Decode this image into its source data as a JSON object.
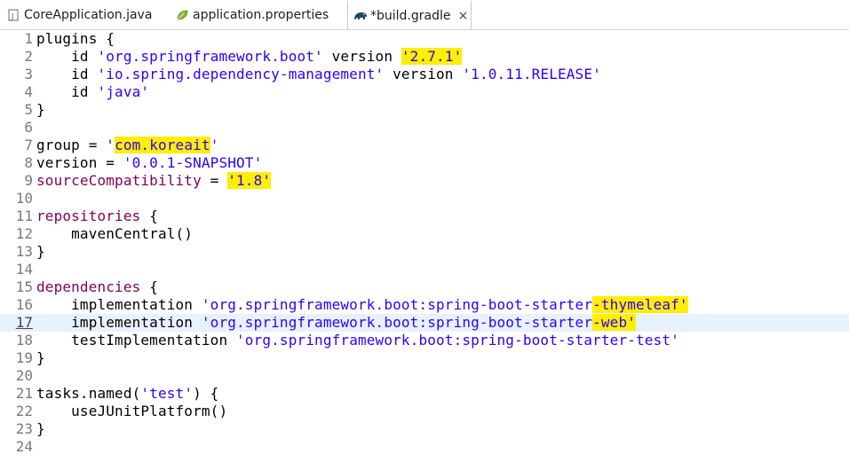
{
  "tabs": [
    {
      "label": "CoreApplication.java",
      "icon": "java-file-icon"
    },
    {
      "label": "application.properties",
      "icon": "properties-leaf-icon"
    },
    {
      "label": "*build.gradle",
      "icon": "gradle-elephant-icon",
      "close": "×"
    }
  ],
  "colors": {
    "string": "#2a00ff",
    "highlight": "#ffee00",
    "current_line": "#e8f2fe"
  },
  "lines": [
    {
      "n": "1",
      "parts": [
        [
          "plugins {",
          ""
        ]
      ]
    },
    {
      "n": "2",
      "parts": [
        [
          "    id ",
          ""
        ],
        [
          "'org.springframework.boot'",
          "s"
        ],
        [
          " version ",
          ""
        ],
        [
          "'2.7.1'",
          "s hl"
        ]
      ]
    },
    {
      "n": "3",
      "parts": [
        [
          "    id ",
          ""
        ],
        [
          "'io.spring.dependency-management'",
          "s"
        ],
        [
          " version ",
          ""
        ],
        [
          "'1.0.11.RELEASE'",
          "s"
        ]
      ]
    },
    {
      "n": "4",
      "parts": [
        [
          "    id ",
          ""
        ],
        [
          "'java'",
          "s"
        ]
      ]
    },
    {
      "n": "5",
      "parts": [
        [
          "}",
          ""
        ]
      ]
    },
    {
      "n": "6",
      "parts": []
    },
    {
      "n": "7",
      "parts": [
        [
          "group = ",
          ""
        ],
        [
          "'",
          "s"
        ],
        [
          "com.koreait",
          "s hl"
        ],
        [
          "'",
          "s"
        ]
      ]
    },
    {
      "n": "8",
      "parts": [
        [
          "version = ",
          ""
        ],
        [
          "'0.0.1-SNAPSHOT'",
          "s"
        ]
      ]
    },
    {
      "n": "9",
      "parts": [
        [
          "sourceCompatibility",
          "k"
        ],
        [
          " = ",
          ""
        ],
        [
          "'1.8'",
          "s hl"
        ]
      ]
    },
    {
      "n": "10",
      "parts": []
    },
    {
      "n": "11",
      "parts": [
        [
          "repositories",
          "k"
        ],
        [
          " {",
          ""
        ]
      ]
    },
    {
      "n": "12",
      "parts": [
        [
          "    mavenCentral()",
          ""
        ]
      ]
    },
    {
      "n": "13",
      "parts": [
        [
          "}",
          ""
        ]
      ]
    },
    {
      "n": "14",
      "parts": []
    },
    {
      "n": "15",
      "parts": [
        [
          "dependencies",
          "k"
        ],
        [
          " {",
          ""
        ]
      ]
    },
    {
      "n": "16",
      "parts": [
        [
          "    implementation ",
          ""
        ],
        [
          "'org.springframework.boot:spring-boot-starter",
          "s"
        ],
        [
          "-thymeleaf'",
          "s hl"
        ]
      ]
    },
    {
      "n": "17",
      "parts": [
        [
          "    implementation ",
          ""
        ],
        [
          "'org.springframework.boot:spring-boot-starter",
          "s"
        ],
        [
          "-web'",
          "s hl"
        ]
      ],
      "current": true
    },
    {
      "n": "18",
      "parts": [
        [
          "    testImplementation ",
          ""
        ],
        [
          "'org.springframework.boot:spring-boot-starter-test'",
          "s"
        ]
      ]
    },
    {
      "n": "19",
      "parts": [
        [
          "}",
          ""
        ]
      ]
    },
    {
      "n": "20",
      "parts": []
    },
    {
      "n": "21",
      "parts": [
        [
          "tasks.named(",
          ""
        ],
        [
          "'test'",
          "s"
        ],
        [
          ") {",
          ""
        ]
      ]
    },
    {
      "n": "22",
      "parts": [
        [
          "    useJUnitPlatform()",
          ""
        ]
      ]
    },
    {
      "n": "23",
      "parts": [
        [
          "}",
          ""
        ]
      ]
    },
    {
      "n": "24",
      "parts": []
    }
  ]
}
